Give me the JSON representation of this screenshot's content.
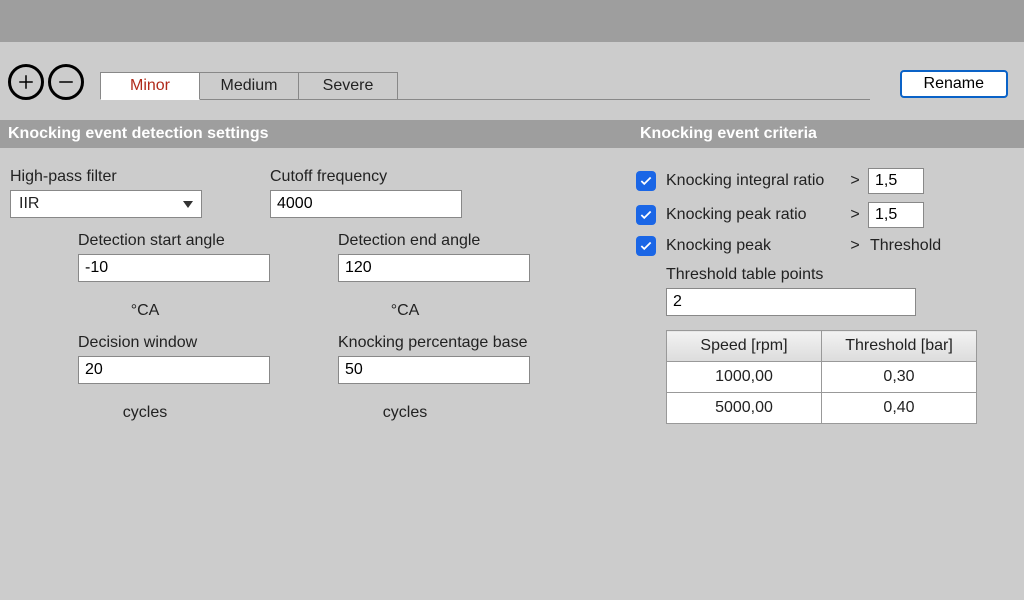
{
  "tabs": {
    "t0": "Minor",
    "t1": "Medium",
    "t2": "Severe"
  },
  "rename_label": "Rename",
  "sections": {
    "left_title": "Knocking event detection settings",
    "right_title": "Knocking event criteria"
  },
  "left": {
    "high_pass_label": "High-pass filter",
    "high_pass_value": "IIR",
    "cutoff_label": "Cutoff frequency",
    "cutoff_value": "4000",
    "start_angle_label": "Detection start angle",
    "start_angle_value": "-10",
    "end_angle_label": "Detection end angle",
    "end_angle_value": "120",
    "angle_unit": "°CA",
    "decision_label": "Decision window",
    "decision_value": "20",
    "pct_base_label": "Knocking percentage base",
    "pct_base_value": "50",
    "cycles_unit": "cycles"
  },
  "criteria": {
    "integral_label": "Knocking integral ratio",
    "integral_value": "1,5",
    "peak_ratio_label": "Knocking peak ratio",
    "peak_ratio_value": "1,5",
    "peak_label": "Knocking peak",
    "threshold_word": "Threshold",
    "gt": ">",
    "table_points_label": "Threshold table points",
    "table_points_value": "2",
    "table": {
      "col1": "Speed [rpm]",
      "col2": "Threshold [bar]",
      "r0c0": "1000,00",
      "r0c1": "0,30",
      "r1c0": "5000,00",
      "r1c1": "0,40"
    }
  }
}
